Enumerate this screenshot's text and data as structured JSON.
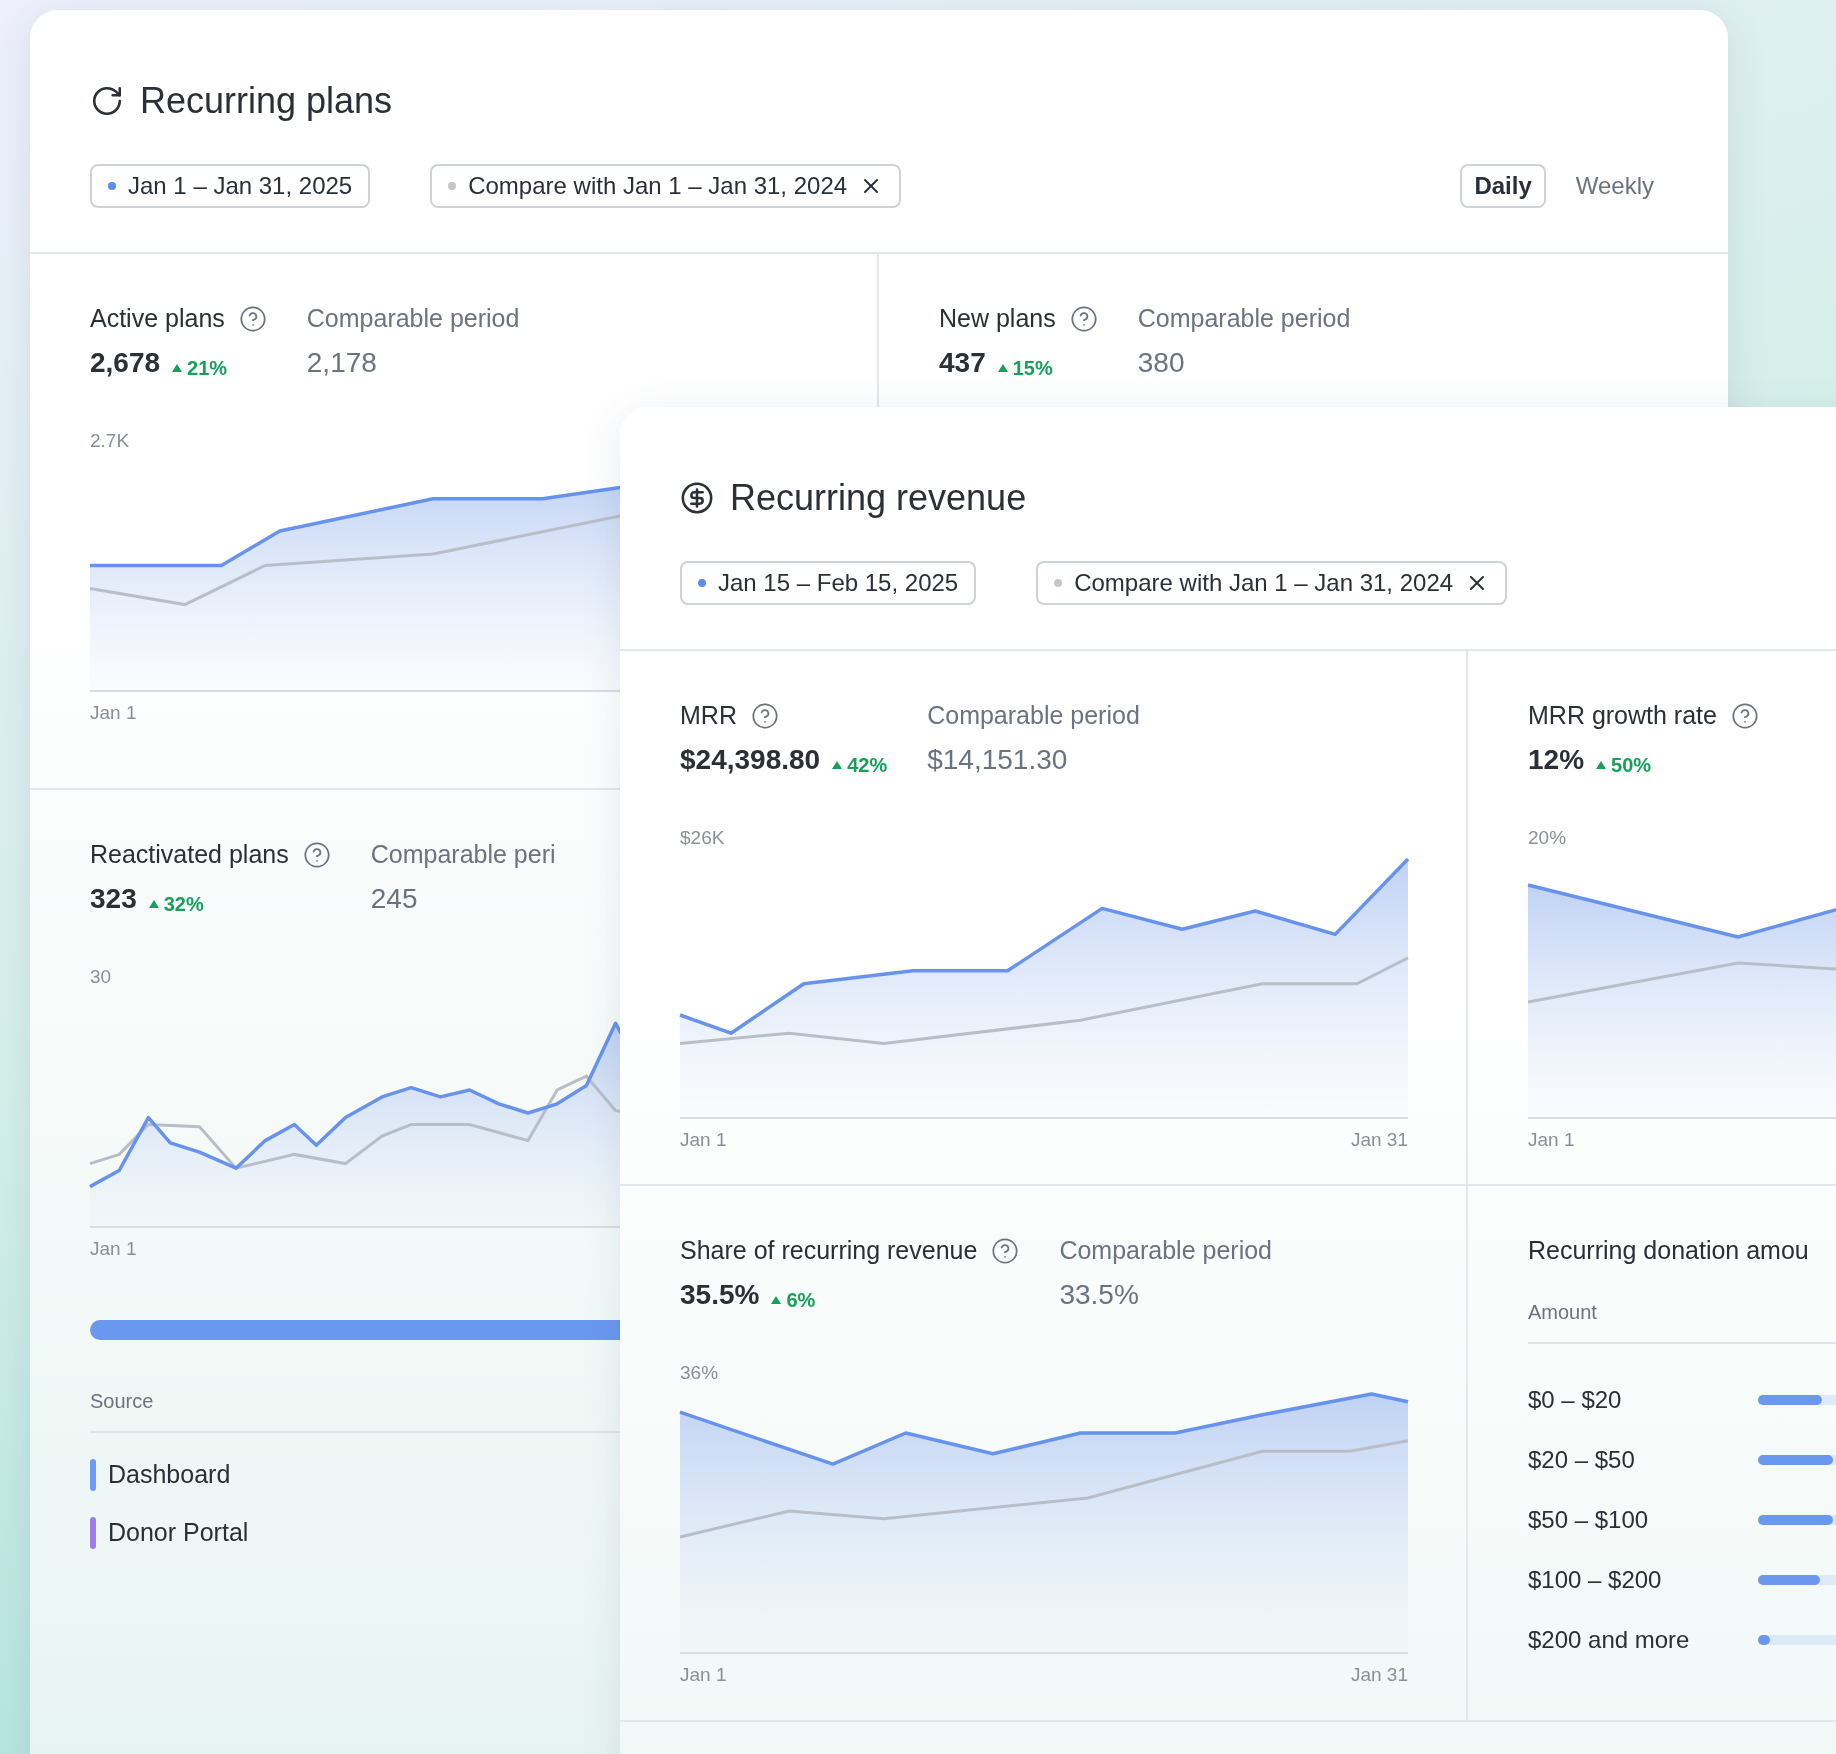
{
  "plans_panel": {
    "title": "Recurring plans",
    "chips": [
      {
        "label": "Jan 1 – Jan 31, 2025",
        "color": "#5b8def",
        "removable": false
      },
      {
        "label": "Compare with Jan 1 – Jan 31, 2024",
        "color": "#c4c7cc",
        "removable": true
      }
    ],
    "intervals": [
      {
        "label": "Daily",
        "selected": true
      },
      {
        "label": "Weekly",
        "selected": false
      }
    ],
    "metrics": [
      {
        "label": "Active plans",
        "value": "2,678",
        "change": "21%",
        "comparable_label": "Comparable period",
        "comparable_value": "2,178",
        "y_tick": "2.7K",
        "x_labels": [
          "Jan 1"
        ]
      },
      {
        "label": "New plans",
        "value": "437",
        "change": "15%",
        "comparable_label": "Comparable period",
        "comparable_value": "380"
      },
      {
        "label": "Reactivated plans",
        "value": "323",
        "change": "32%",
        "comparable_label": "Comparable peri",
        "comparable_value": "245",
        "y_tick": "30",
        "x_labels": [
          "Jan 1"
        ]
      }
    ],
    "source": {
      "heading": "Source",
      "items": [
        {
          "label": "Dashboard",
          "color": "#6b9bf2"
        },
        {
          "label": "Donor Portal",
          "color": "#9d7ee9"
        }
      ]
    }
  },
  "revenue_panel": {
    "title": "Recurring revenue",
    "chips": [
      {
        "label": "Jan 15 – Feb 15, 2025",
        "color": "#5b8def",
        "removable": false
      },
      {
        "label": "Compare with Jan 1 – Jan 31, 2024",
        "color": "#c4c7cc",
        "removable": true
      }
    ],
    "metrics": [
      {
        "label": "MRR",
        "value": "$24,398.80",
        "change": "42%",
        "comparable_label": "Comparable period",
        "comparable_value": "$14,151.30",
        "y_tick": "$26K",
        "x_labels": [
          "Jan 1",
          "Jan 31"
        ]
      },
      {
        "label": "MRR growth rate",
        "value": "12%",
        "change": "50%",
        "y_tick": "20%",
        "x_labels": [
          "Jan 1"
        ]
      },
      {
        "label": "Share of recurring revenue",
        "value": "35.5%",
        "change": "6%",
        "comparable_label": "Comparable period",
        "comparable_value": "33.5%",
        "y_tick": "36%",
        "x_labels": [
          "Jan 1",
          "Jan 31"
        ]
      }
    ],
    "distribution": {
      "title": "Recurring donation amou",
      "column_heading": "Amount",
      "rows": [
        {
          "label": "$0 – $20",
          "level": 0.82
        },
        {
          "label": "$20 – $50",
          "level": 0.96
        },
        {
          "label": "$50 – $100",
          "level": 0.96
        },
        {
          "label": "$100 – $200",
          "level": 0.8
        },
        {
          "label": "$200 and more",
          "level": 0.15
        }
      ]
    }
  }
}
